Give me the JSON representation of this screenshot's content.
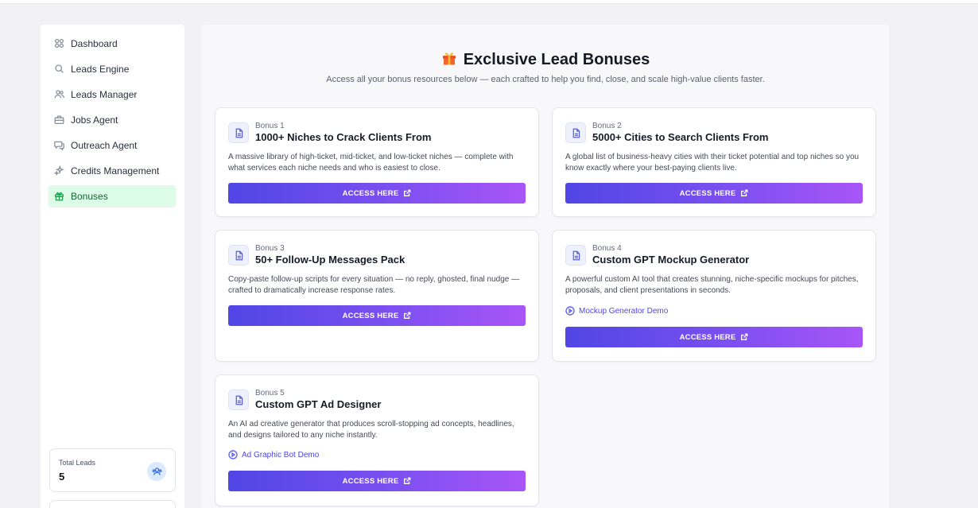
{
  "sidebar": {
    "items": [
      {
        "label": "Dashboard",
        "icon": "dashboard-icon"
      },
      {
        "label": "Leads Engine",
        "icon": "search-icon"
      },
      {
        "label": "Leads Manager",
        "icon": "users-icon"
      },
      {
        "label": "Jobs Agent",
        "icon": "briefcase-icon"
      },
      {
        "label": "Outreach Agent",
        "icon": "chat-icon"
      },
      {
        "label": "Credits Management",
        "icon": "sparkles-icon"
      },
      {
        "label": "Bonuses",
        "icon": "gift-icon",
        "active": true
      }
    ],
    "total_leads_label": "Total Leads",
    "total_leads_value": "5"
  },
  "main": {
    "title": "Exclusive Lead Bonuses",
    "subtitle": "Access all your bonus resources below — each crafted to help you find, close, and scale high-value clients faster.",
    "accent_color": "#4f46e5",
    "cards": [
      {
        "num": "Bonus 1",
        "title": "1000+ Niches to Crack Clients From",
        "desc": "A massive library of high-ticket, mid-ticket, and low-ticket niches — complete with what services each niche needs and who is easiest to close.",
        "button": "ACCESS HERE"
      },
      {
        "num": "Bonus 2",
        "title": "5000+ Cities to Search Clients From",
        "desc": "A global list of business-heavy cities with their ticket potential and top niches so you know exactly where your best-paying clients live.",
        "button": "ACCESS HERE"
      },
      {
        "num": "Bonus 3",
        "title": "50+ Follow-Up Messages Pack",
        "desc": "Copy-paste follow-up scripts for every situation — no reply, ghosted, final nudge — crafted to dramatically increase response rates.",
        "button": "ACCESS HERE"
      },
      {
        "num": "Bonus 4",
        "title": "Custom GPT Mockup Generator",
        "desc": "A powerful custom AI tool that creates stunning, niche-specific mockups for pitches, proposals, and client presentations in seconds.",
        "demo": "Mockup Generator Demo",
        "button": "ACCESS HERE"
      },
      {
        "num": "Bonus 5",
        "title": "Custom GPT Ad Designer",
        "desc": "An AI ad creative generator that produces scroll-stopping ad concepts, headlines, and designs tailored to any niche instantly.",
        "demo": "Ad Graphic Bot Demo",
        "button": "ACCESS HERE"
      }
    ]
  }
}
